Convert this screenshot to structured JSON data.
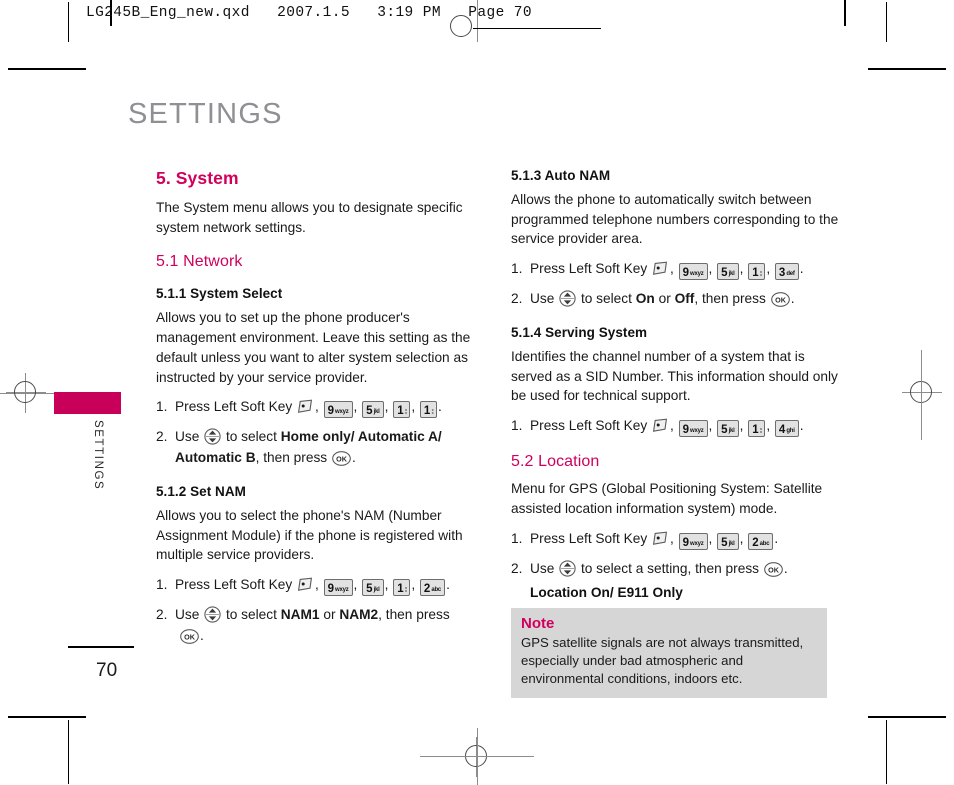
{
  "file_header": {
    "text": "LG245B_Eng_new.qxd   2007.1.5   3:19 PM   Page 70"
  },
  "chapter": {
    "title": "SETTINGS",
    "tab_label": "SETTINGS",
    "page_number": "70"
  },
  "left_column": {
    "section_title": "5. System",
    "intro": "The System menu allows you to designate specific system network settings.",
    "subsection_title": "5.1 Network",
    "s111": {
      "heading": "5.1.1 System Select",
      "body": "Allows you to set up the phone producer's management environment. Leave this setting as the default unless you want to alter system selection as instructed by your service provider.",
      "step1_num": "1.",
      "step1_pre": "Press Left Soft Key",
      "step1_keys": [
        "9wxyz",
        "5jkl",
        "1dots",
        "1dots"
      ],
      "step2_num": "2.",
      "step2_pre": "Use",
      "step2_mid": "to select",
      "step2_bold_a": "Home only/ Automatic A/",
      "step2_bold_b": "Automatic B",
      "step2_post": ", then press"
    },
    "s112": {
      "heading": "5.1.2 Set NAM",
      "body": "Allows you to select the phone's NAM (Number Assignment Module) if the phone is registered with multiple service providers.",
      "step1_num": "1.",
      "step1_pre": "Press Left Soft Key",
      "step1_keys": [
        "9wxyz",
        "5jkl",
        "1dots",
        "2abc"
      ],
      "step2_num": "2.",
      "step2_pre": "Use",
      "step2_mid": "to select",
      "step2_bold_a": "NAM1",
      "step2_conj": "or",
      "step2_bold_b": "NAM2",
      "step2_post": ", then press"
    }
  },
  "right_column": {
    "s113": {
      "heading": "5.1.3 Auto NAM",
      "body": "Allows the phone to automatically switch between programmed telephone numbers corresponding to the service provider area.",
      "step1_num": "1.",
      "step1_pre": "Press Left Soft Key",
      "step1_keys": [
        "9wxyz",
        "5jkl",
        "1dots",
        "3def"
      ],
      "step2_num": "2.",
      "step2_pre": "Use",
      "step2_mid": "to select",
      "step2_bold_a": "On",
      "step2_conj": "or",
      "step2_bold_b": "Off",
      "step2_post": ", then press"
    },
    "s114": {
      "heading": "5.1.4 Serving System",
      "body": "Identifies the channel number of a system that is served as a SID Number. This information should only be used for technical support.",
      "step1_num": "1.",
      "step1_pre": "Press Left Soft Key",
      "step1_keys": [
        "9wxyz",
        "5jkl",
        "1dots",
        "4ghi"
      ]
    },
    "s52": {
      "heading": "5.2 Location",
      "body": "Menu for GPS (Global Positioning System: Satellite assisted location information system) mode.",
      "step1_num": "1.",
      "step1_pre": "Press Left Soft Key",
      "step1_keys": [
        "9wxyz",
        "5jkl",
        "2abc"
      ],
      "step2_num": "2.",
      "step2_pre": "Use",
      "step2_mid": "to select a setting, then press",
      "options_line": "Location On/ E911  Only"
    },
    "note": {
      "title": "Note",
      "body": "GPS satellite signals are not always transmitted, especially under bad atmospheric and environmental conditions, indoors etc."
    }
  },
  "keys": {
    "9wxyz": {
      "digit": "9",
      "letters": "wxyz"
    },
    "5jkl": {
      "digit": "5",
      "letters": "jkl"
    },
    "1dots": {
      "digit": "1",
      "letters": "∶∶"
    },
    "2abc": {
      "digit": "2",
      "letters": "abc"
    },
    "3def": {
      "digit": "3",
      "letters": "def"
    },
    "4ghi": {
      "digit": "4",
      "letters": "ghi"
    }
  },
  "icons": {
    "soft_key": "left-soft-key-icon",
    "nav_key": "up-down-navigation-key-icon",
    "ok_key": "ok-key-icon",
    "ok_label": "OK"
  },
  "colors": {
    "brand_magenta": "#d1005d",
    "tab_magenta": "#c8005a",
    "title_gray": "#8f8f94",
    "note_bg": "#d6d6d6",
    "key_face": "#e2e2e2"
  }
}
